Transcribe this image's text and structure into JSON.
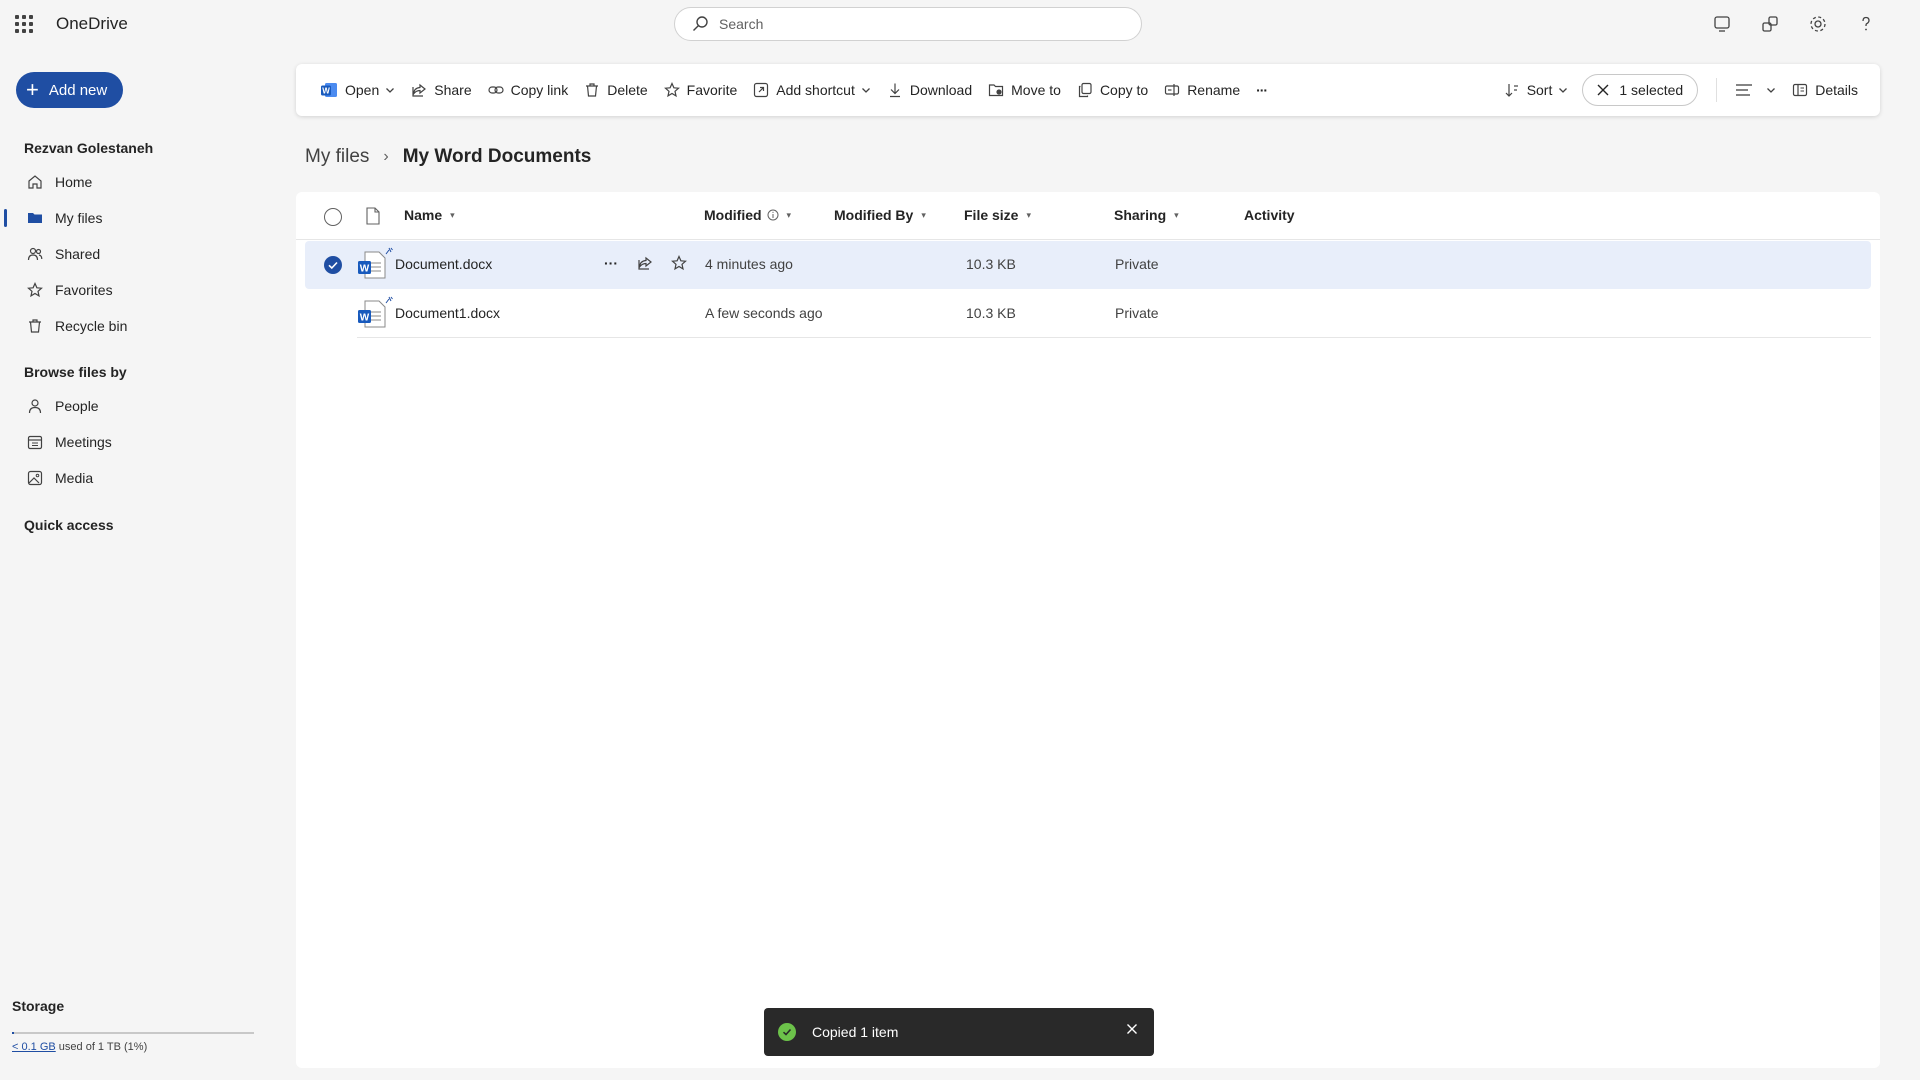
{
  "app": {
    "title": "OneDrive"
  },
  "search": {
    "placeholder": "Search"
  },
  "sidebar": {
    "add_new_label": "Add new",
    "user_name": "Rezvan Golestaneh",
    "items": [
      {
        "label": "Home",
        "icon": "home-icon"
      },
      {
        "label": "My files",
        "icon": "folder-icon",
        "active": true
      },
      {
        "label": "Shared",
        "icon": "people-icon"
      },
      {
        "label": "Favorites",
        "icon": "star-icon"
      },
      {
        "label": "Recycle bin",
        "icon": "trash-icon"
      }
    ],
    "browse_heading": "Browse files by",
    "browse_items": [
      {
        "label": "People",
        "icon": "person-icon"
      },
      {
        "label": "Meetings",
        "icon": "calendar-icon"
      },
      {
        "label": "Media",
        "icon": "image-icon"
      }
    ],
    "quick_access_heading": "Quick access",
    "storage": {
      "title": "Storage",
      "used_link": "< 0.1 GB",
      "used_text": "used of 1 TB (1%)",
      "fraction": 0.01
    }
  },
  "toolbar": {
    "open": "Open",
    "share": "Share",
    "copy_link": "Copy link",
    "delete": "Delete",
    "favorite": "Favorite",
    "add_shortcut": "Add shortcut",
    "download": "Download",
    "move_to": "Move to",
    "copy_to": "Copy to",
    "rename": "Rename",
    "more": "···",
    "sort": "Sort",
    "selected": "1 selected",
    "details": "Details"
  },
  "breadcrumb": {
    "parent": "My files",
    "current": "My Word Documents"
  },
  "table": {
    "columns": {
      "name": "Name",
      "modified": "Modified",
      "modified_by": "Modified By",
      "file_size": "File size",
      "sharing": "Sharing",
      "activity": "Activity"
    },
    "rows": [
      {
        "name": "Document.docx",
        "modified": "4 minutes ago",
        "modified_by": "",
        "size": "10.3 KB",
        "sharing": "Private",
        "selected": true
      },
      {
        "name": "Document1.docx",
        "modified": "A few seconds ago",
        "modified_by": "",
        "size": "10.3 KB",
        "sharing": "Private",
        "selected": false
      }
    ]
  },
  "toast": {
    "message": "Copied 1 item"
  },
  "colors": {
    "accent": "#1f4ea3",
    "selected_row": "#e8eefa",
    "word_blue": "#185abd",
    "success": "#6cc24a"
  }
}
